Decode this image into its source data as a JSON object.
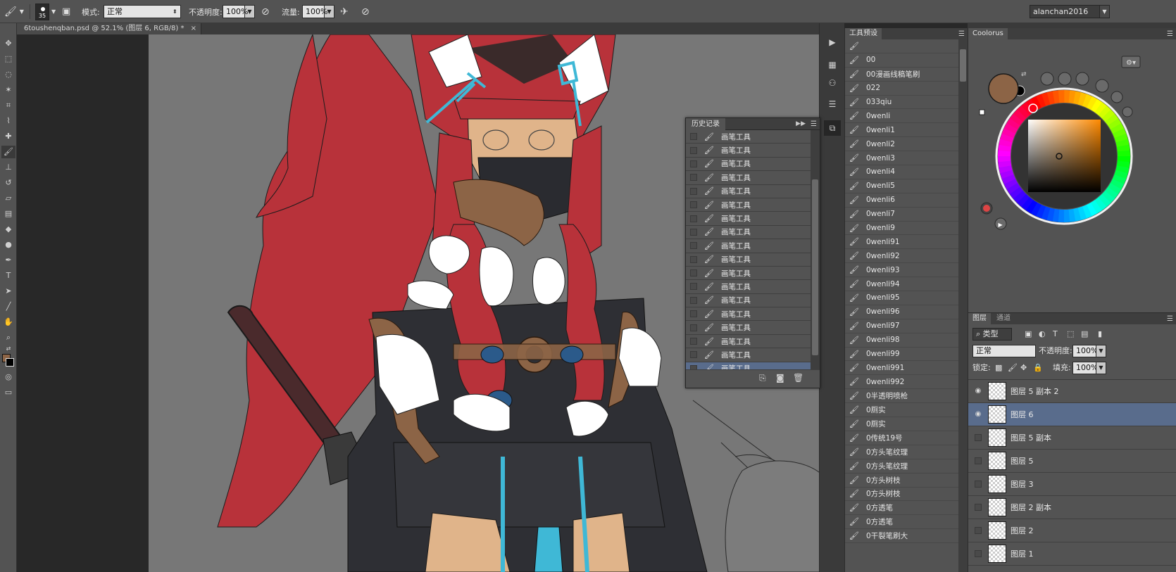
{
  "options_bar": {
    "brush_size": "35",
    "mode_label": "模式:",
    "mode_value": "正常",
    "opacity_label": "不透明度:",
    "opacity_value": "100%",
    "flow_label": "流量:",
    "flow_value": "100%",
    "user": "alanchan2016"
  },
  "document": {
    "tab_title": "6toushenqban.psd @ 52.1% (图层 6, RGB/8) *",
    "close_glyph": "×"
  },
  "history": {
    "title": "历史记录",
    "items": [
      "画笔工具",
      "画笔工具",
      "画笔工具",
      "画笔工具",
      "画笔工具",
      "画笔工具",
      "画笔工具",
      "画笔工具",
      "画笔工具",
      "画笔工具",
      "画笔工具",
      "画笔工具",
      "画笔工具",
      "画笔工具",
      "画笔工具",
      "画笔工具",
      "画笔工具",
      "画笔工具"
    ],
    "selected_index": 17
  },
  "presets": {
    "title": "工具预设",
    "items": [
      "",
      "00",
      "00漫画线稿笔刷",
      "022",
      "033qiu",
      "0wenli",
      "0wenli1",
      "0wenli2",
      "0wenli3",
      "0wenli4",
      "0wenli5",
      "0wenli6",
      "0wenli7",
      "0wenli9",
      "0wenli91",
      "0wenli92",
      "0wenli93",
      "0wenli94",
      "0wenli95",
      "0wenli96",
      "0wenli97",
      "0wenli98",
      "0wenli99",
      "0wenli991",
      "0wenli992",
      "0半透明喷枪",
      "0厕实",
      "0厕实",
      "0传统19号",
      "0方头笔纹理",
      "0方头笔纹理",
      "0方头树枝",
      "0方头树枝",
      "0方透笔",
      "0方透笔",
      "0干裂笔刷大"
    ]
  },
  "coolorus": {
    "title": "Coolorus",
    "fg_color": "#8c6446",
    "bg_color": "#000000"
  },
  "layers": {
    "tabs": [
      "图层",
      "通道"
    ],
    "filter_value": "类型",
    "blend_mode": "正常",
    "opacity_label": "不透明度:",
    "opacity_value": "100%",
    "lock_label": "锁定:",
    "fill_label": "填充:",
    "fill_value": "100%",
    "items": [
      {
        "name": "图层 5 副本 2",
        "visible": true
      },
      {
        "name": "图层 6",
        "visible": true,
        "selected": true
      },
      {
        "name": "图层 5 副本",
        "visible": false
      },
      {
        "name": "图层 5",
        "visible": false
      },
      {
        "name": "图层 3",
        "visible": false
      },
      {
        "name": "图层 2 副本",
        "visible": false
      },
      {
        "name": "图层 2",
        "visible": false
      },
      {
        "name": "图层 1",
        "visible": false
      }
    ]
  },
  "colors": {
    "panel": "#535353",
    "selection": "#596c8c",
    "hair": "#b8323a",
    "skin": "#e0b48a",
    "cloth": "#2e2f34",
    "ribbon": "#3fb8d6",
    "canvas_bg": "#777777"
  }
}
